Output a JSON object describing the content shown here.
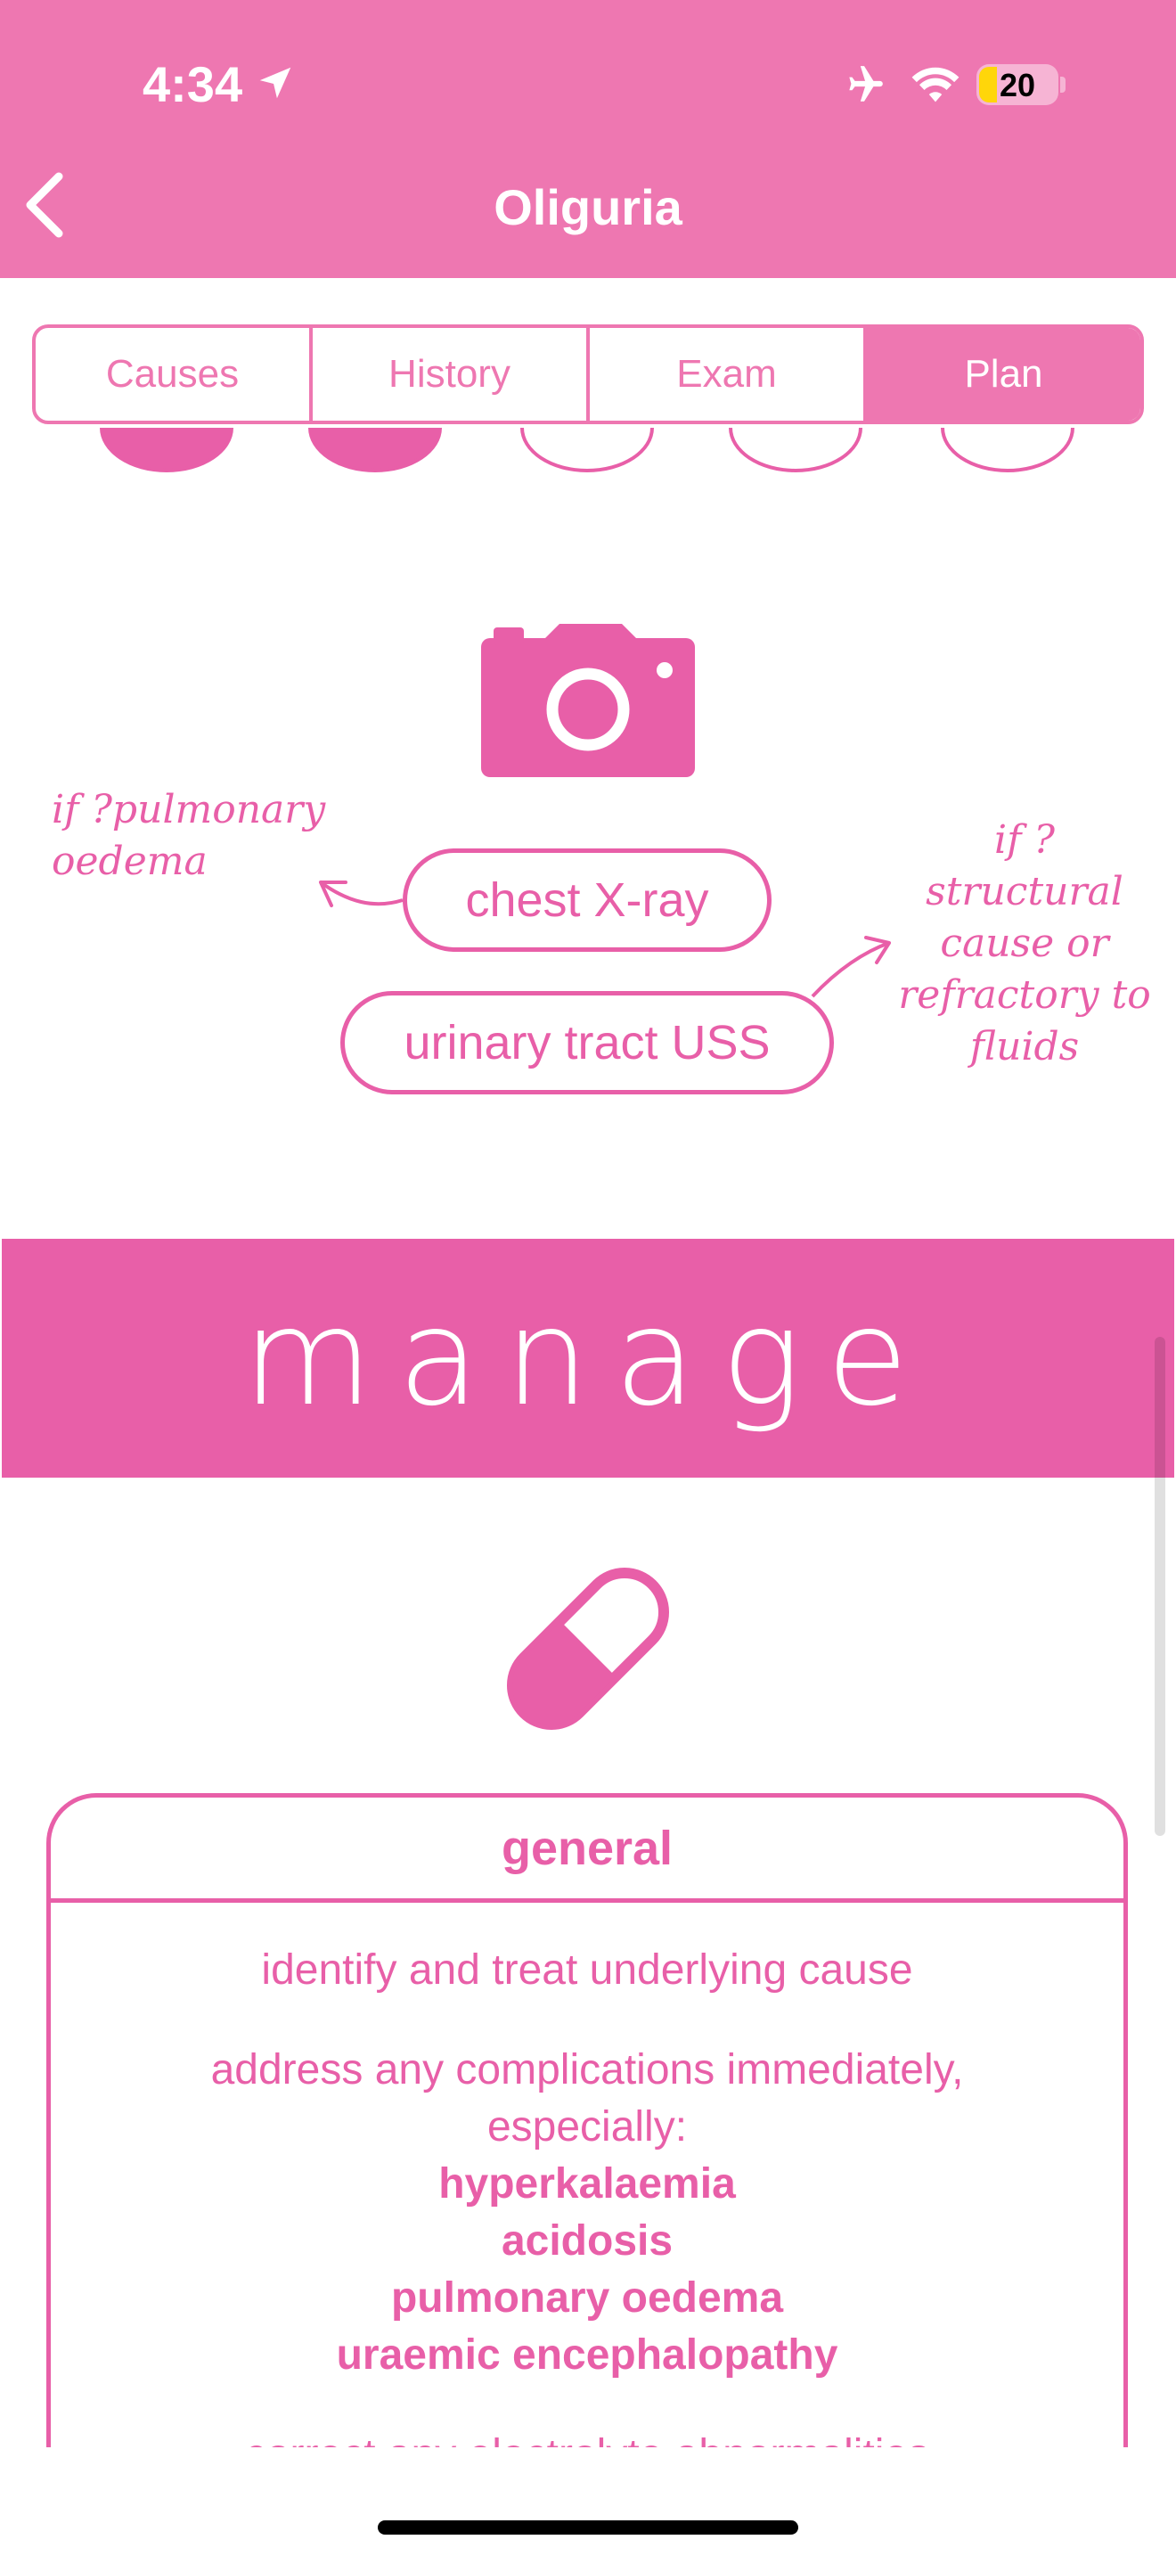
{
  "status_bar": {
    "time": "4:34",
    "battery": "20"
  },
  "header": {
    "title": "Oliguria"
  },
  "tabs": [
    {
      "label": "Causes",
      "active": false
    },
    {
      "label": "History",
      "active": false
    },
    {
      "label": "Exam",
      "active": false
    },
    {
      "label": "Plan",
      "active": true
    }
  ],
  "investigations": {
    "note_left": "if ?pulmonary oedema",
    "note_right": "if ? structural cause or refractory to fluids",
    "chest_xray": "chest X-ray",
    "uss": "urinary tract USS"
  },
  "section": {
    "title": "manage"
  },
  "general_card": {
    "title": "general",
    "item1": "identify and treat underlying cause",
    "item2_line1": "address any complications immediately,",
    "item2_line2": "especially:",
    "complications": [
      "hyperkalaemia",
      "acidosis",
      "pulmonary oedema",
      "uraemic encephalopathy"
    ],
    "item3": "correct any electrolyte abnormalities"
  },
  "colors": {
    "header": "#ee77b1",
    "accent": "#e85fa8",
    "background": "#ffffff"
  },
  "icons": [
    "location-arrow-icon",
    "airplane-icon",
    "wifi-icon",
    "battery-icon",
    "chevron-left-icon",
    "camera-icon",
    "capsule-icon"
  ]
}
